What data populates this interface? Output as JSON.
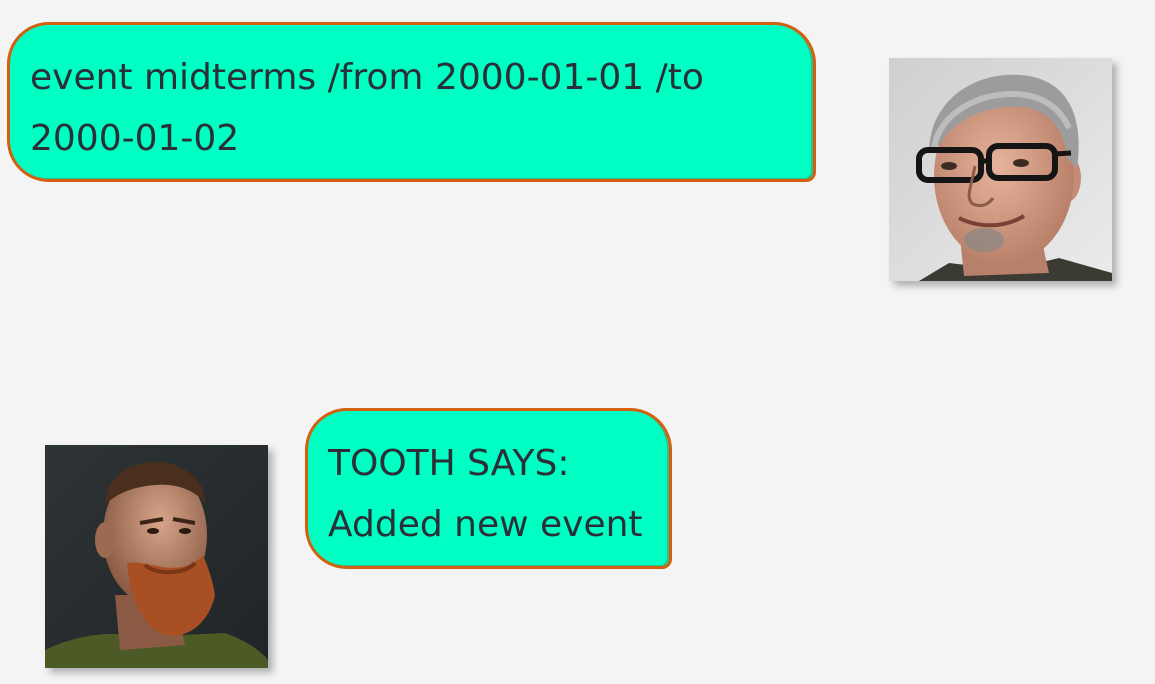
{
  "chat": {
    "user_message": {
      "line1": "event midterms /from 2000-01-01 /to",
      "line2": "2000-01-02",
      "avatar_icon": "user-avatar-icon"
    },
    "bot_message": {
      "line1": "TOOTH SAYS:",
      "line2": "Added new event",
      "avatar_icon": "bot-avatar-icon"
    }
  },
  "colors": {
    "background": "#f4f4f4",
    "bubble_fill": "#00ffc3",
    "bubble_border": "#d2600e",
    "text": "#2a2f38"
  }
}
